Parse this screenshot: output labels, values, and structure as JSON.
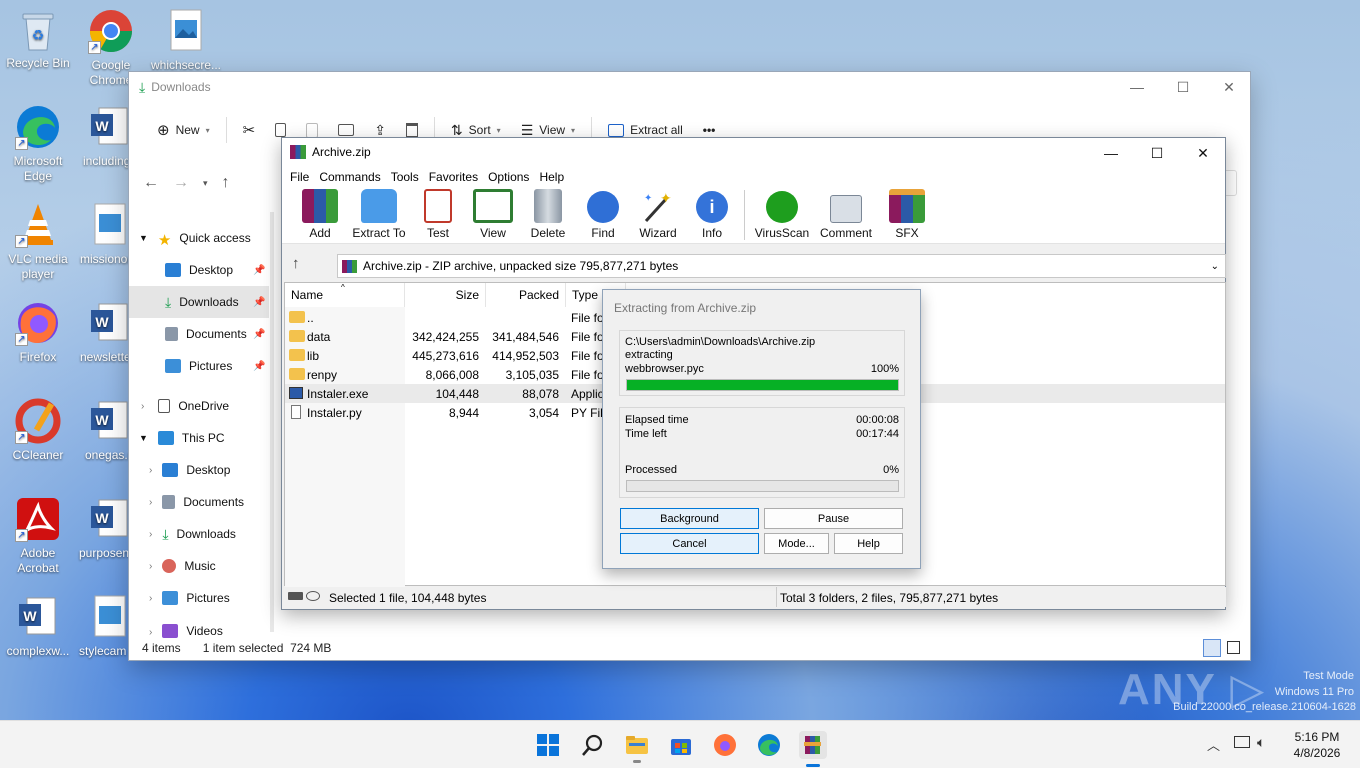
{
  "desktop": {
    "icons": [
      {
        "label": "Recycle Bin",
        "icon": "recycle-bin-icon"
      },
      {
        "label": "Google Chrome",
        "icon": "chrome-icon"
      },
      {
        "label": "whichsecre...",
        "icon": "image-file-icon"
      },
      {
        "label": "Microsoft Edge",
        "icon": "edge-icon"
      },
      {
        "label": "including",
        "icon": "word-doc-icon"
      },
      {
        "label": "VLC media player",
        "icon": "vlc-icon"
      },
      {
        "label": "missionor",
        "icon": "image-file-icon"
      },
      {
        "label": "Firefox",
        "icon": "firefox-icon"
      },
      {
        "label": "newslette",
        "icon": "word-doc-icon"
      },
      {
        "label": "CCleaner",
        "icon": "ccleaner-icon"
      },
      {
        "label": "onegas.rt",
        "icon": "word-doc-icon"
      },
      {
        "label": "Adobe Acrobat",
        "icon": "acrobat-icon"
      },
      {
        "label": "purposen",
        "icon": "word-doc-icon"
      },
      {
        "label": "complexw...",
        "icon": "word-doc-icon"
      },
      {
        "label": "stylecam",
        "icon": "image-file-icon"
      }
    ]
  },
  "explorer": {
    "title": "Downloads",
    "toolbar": {
      "new": "New",
      "sort": "Sort",
      "view": "View",
      "extract_all": "Extract all",
      "more": "•••"
    },
    "nav": {
      "quick_access": "Quick access",
      "desktop": "Desktop",
      "downloads": "Downloads",
      "documents": "Documents",
      "pictures": "Pictures",
      "onedrive": "OneDrive",
      "this_pc": "This PC",
      "pc_desktop": "Desktop",
      "pc_documents": "Documents",
      "pc_downloads": "Downloads",
      "music": "Music",
      "pc_pictures": "Pictures",
      "videos": "Videos"
    },
    "status": {
      "items": "4 items",
      "selected": "1 item selected",
      "size": "724 MB"
    }
  },
  "winrar": {
    "title": "Archive.zip",
    "menu": [
      "File",
      "Commands",
      "Tools",
      "Favorites",
      "Options",
      "Help"
    ],
    "tools": [
      "Add",
      "Extract To",
      "Test",
      "View",
      "Delete",
      "Find",
      "Wizard",
      "Info",
      "VirusScan",
      "Comment",
      "SFX"
    ],
    "path": "Archive.zip - ZIP archive, unpacked size 795,877,271 bytes",
    "columns": {
      "name": "Name",
      "size": "Size",
      "packed": "Packed",
      "type": "Type"
    },
    "rows": [
      {
        "name": "..",
        "size": "",
        "packed": "",
        "type": "File fo"
      },
      {
        "name": "data",
        "size": "342,424,255",
        "packed": "341,484,546",
        "type": "File fo"
      },
      {
        "name": "lib",
        "size": "445,273,616",
        "packed": "414,952,503",
        "type": "File fo"
      },
      {
        "name": "renpy",
        "size": "8,066,008",
        "packed": "3,105,035",
        "type": "File fo"
      },
      {
        "name": "Instaler.exe",
        "size": "104,448",
        "packed": "88,078",
        "type": "Applic"
      },
      {
        "name": "Instaler.py",
        "size": "8,944",
        "packed": "3,054",
        "type": "PY File"
      }
    ],
    "status_left": "Selected 1 file, 104,448 bytes",
    "status_right": "Total 3 folders, 2 files, 795,877,271 bytes"
  },
  "dialog": {
    "title": "Extracting from Archive.zip",
    "path": "C:\\Users\\admin\\Downloads\\Archive.zip",
    "action": "extracting",
    "file": "webbrowser.pyc",
    "file_percent": "100%",
    "file_progress": 1.0,
    "elapsed_label": "Elapsed time",
    "elapsed": "00:00:08",
    "left_label": "Time left",
    "left": "00:17:44",
    "processed_label": "Processed",
    "processed": "0%",
    "processed_progress": 0.0,
    "buttons": {
      "background": "Background",
      "pause": "Pause",
      "cancel": "Cancel",
      "mode": "Mode...",
      "help": "Help"
    }
  },
  "watermark": {
    "brand": "ANY RUN",
    "line1": "Test Mode",
    "line2": "Windows 11 Pro",
    "line3": "Build 22000.co_release.210604-1628"
  },
  "taskbar": {
    "time": "5:16 PM",
    "date": "4/8/2026"
  },
  "colors": {
    "progress": "#06b025",
    "accent": "#0078d7"
  }
}
